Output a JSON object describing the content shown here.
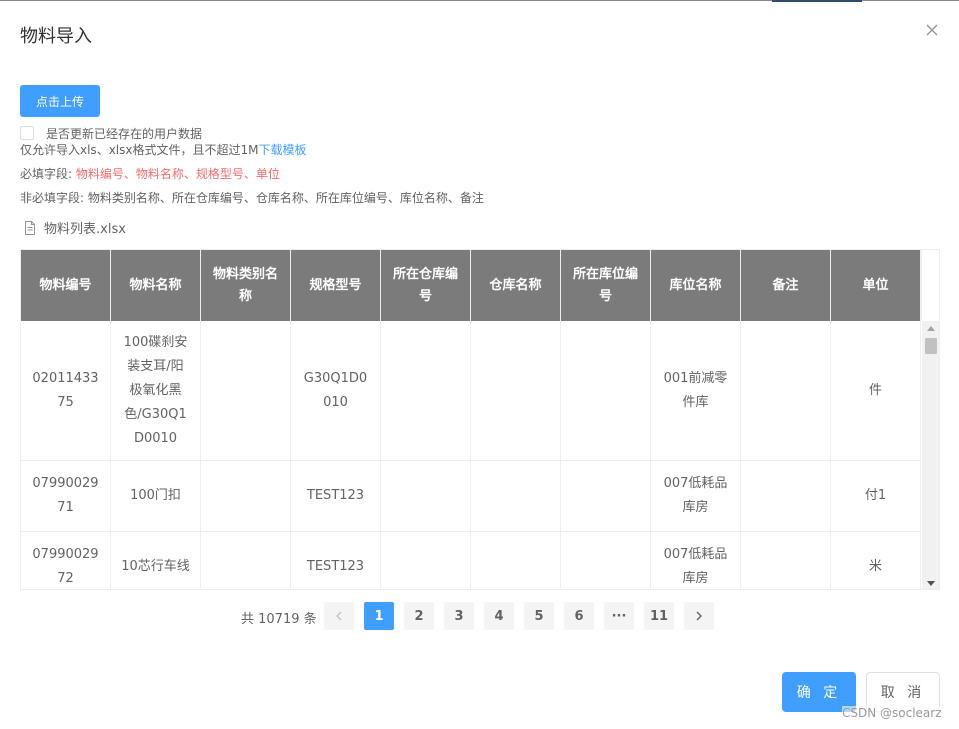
{
  "dialog": {
    "title": "物料导入",
    "upload_label": "点击上传",
    "update_checkbox_label": "是否更新已经存在的用户数据",
    "tip_text": "仅允许导入xls、xlsx格式文件，且不超过1M",
    "tip_link": "下载模板",
    "required_prefix": "必填字段: ",
    "required_fields": "物料编号、物料名称、规格型号、单位",
    "optional_text": "非必填字段: 物料类别名称、所在仓库编号、仓库名称、所在库位编号、库位名称、备注",
    "file_name": "物料列表.xlsx"
  },
  "table": {
    "columns": [
      "物料编号",
      "物料名称",
      "物料类别名称",
      "规格型号",
      "所在仓库编号",
      "仓库名称",
      "所在库位编号",
      "库位名称",
      "备注",
      "单位"
    ],
    "rows": [
      [
        "0201143375",
        "100碟刹安装支耳/阳极氧化黑色/G30Q1D0010",
        "",
        "G30Q1D0010",
        "",
        "",
        "",
        "001前减零件库",
        "",
        "件"
      ],
      [
        "0799002971",
        "100门扣",
        "",
        "TEST123",
        "",
        "",
        "",
        "007低耗品库房",
        "",
        "付1"
      ],
      [
        "0799002972",
        "10芯行车线",
        "",
        "TEST123",
        "",
        "",
        "",
        "007低耗品库房",
        "",
        "米"
      ]
    ]
  },
  "pagination": {
    "total": "共 10719 条",
    "pages": [
      "1",
      "2",
      "3",
      "4",
      "5",
      "6",
      "···",
      "11"
    ],
    "current": "1"
  },
  "footer": {
    "ok_label": "确 定",
    "cancel_label": "取 消"
  },
  "watermark": "CSDN @soclearz",
  "colors": {
    "primary": "#409eff",
    "header_bg": "#7b7b7b",
    "required_red": "#f56c6c"
  }
}
